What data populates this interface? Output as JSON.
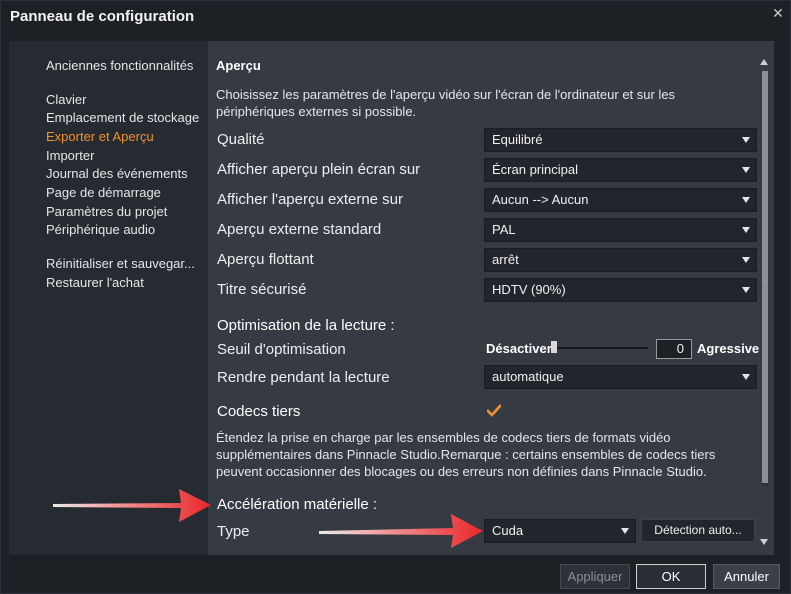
{
  "window": {
    "title": "Panneau de configuration"
  },
  "sidebar": {
    "items": [
      {
        "label": "Anciennes fonctionnalités",
        "active": false
      },
      {
        "label": "Clavier",
        "active": false
      },
      {
        "label": "Emplacement de stockage",
        "active": false
      },
      {
        "label": "Exporter et Aperçu",
        "active": true
      },
      {
        "label": "Importer",
        "active": false
      },
      {
        "label": "Journal des événements",
        "active": false
      },
      {
        "label": "Page de démarrage",
        "active": false
      },
      {
        "label": "Paramètres du projet",
        "active": false
      },
      {
        "label": "Périphérique audio",
        "active": false
      },
      {
        "label": "Réinitialiser et sauvegar...",
        "active": false
      },
      {
        "label": "Restaurer l'achat",
        "active": false
      }
    ]
  },
  "content": {
    "preview_heading": "Aperçu",
    "preview_desc": "Choisissez les paramètres de l'aperçu vidéo sur l'écran de l'ordinateur et sur les périphériques externes si possible.",
    "settings": [
      {
        "label": "Qualité",
        "value": "Equilibré"
      },
      {
        "label": "Afficher aperçu plein écran sur",
        "value": "Écran principal"
      },
      {
        "label": "Afficher l'aperçu externe sur",
        "value": "Aucun --> Aucun"
      },
      {
        "label": "Aperçu externe standard",
        "value": "PAL"
      },
      {
        "label": "Aperçu flottant",
        "value": "arrêt"
      },
      {
        "label": "Titre sécurisé",
        "value": "HDTV (90%)"
      }
    ],
    "playback_heading": "Optimisation de la lecture :",
    "threshold": {
      "label": "Seuil d'optimisation",
      "min_label": "Désactiver",
      "max_label": "Agressive",
      "value": "0"
    },
    "render": {
      "label": "Rendre pendant la lecture",
      "value": "automatique"
    },
    "codecs": {
      "label": "Codecs tiers",
      "checked": true,
      "desc": "Étendez la prise en charge par les ensembles de codecs tiers de formats vidéo supplémentaires dans Pinnacle Studio.Remarque : certains ensembles de codecs tiers peuvent occasionner des blocages ou des erreurs non définies dans Pinnacle Studio."
    },
    "hw_heading": "Accélération matérielle :",
    "hw_type": {
      "label": "Type",
      "value": "Cuda",
      "detect_label": "Détection auto..."
    }
  },
  "buttons": {
    "apply": "Appliquer",
    "ok": "OK",
    "cancel": "Annuler"
  },
  "colors": {
    "accent": "#f0912e",
    "arrow": "#e8262a"
  }
}
